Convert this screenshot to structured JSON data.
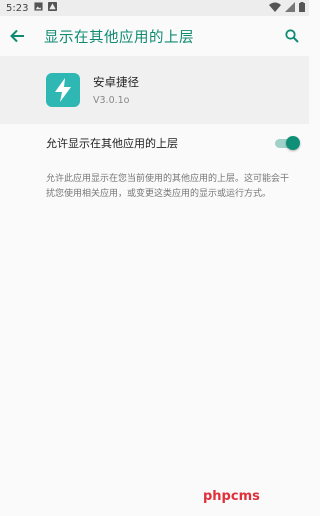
{
  "status_bar": {
    "time": "5:23",
    "left_icons": [
      "image-icon",
      "warning-icon"
    ],
    "right_icons": [
      "wifi-icon",
      "signal-icon",
      "battery-icon"
    ]
  },
  "app_bar": {
    "title": "显示在其他应用的上层",
    "back_icon": "arrow-back-icon",
    "search_icon": "search-icon"
  },
  "app": {
    "name": "安卓捷径",
    "version": "V3.0.1o",
    "icon": "lightning-icon",
    "icon_color": "#2fb7b3"
  },
  "permission": {
    "label": "允许显示在其他应用的上层",
    "enabled": true,
    "accent_color": "#0f8f78"
  },
  "description": "允许此应用显示在您当前使用的其他应用的上层。这可能会干扰您使用相关应用，或变更这类应用的显示或运行方式。",
  "watermark": "phpcms"
}
